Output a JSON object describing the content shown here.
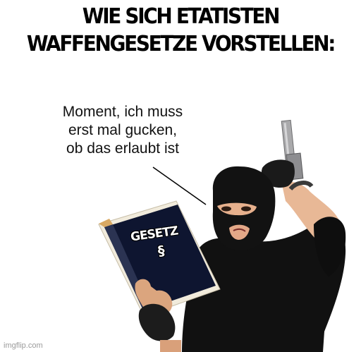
{
  "meme": {
    "title_line1": "WIE SICH ETATISTEN",
    "title_line2": "WAFFENGESETZE VORSTELLEN:",
    "speech_line1": "Moment, ich muss",
    "speech_line2": "erst mal gucken,",
    "speech_line3": "ob das erlaubt ist",
    "book_title": "GESETZ",
    "book_symbol": "§",
    "watermark": "imgflip.com"
  }
}
